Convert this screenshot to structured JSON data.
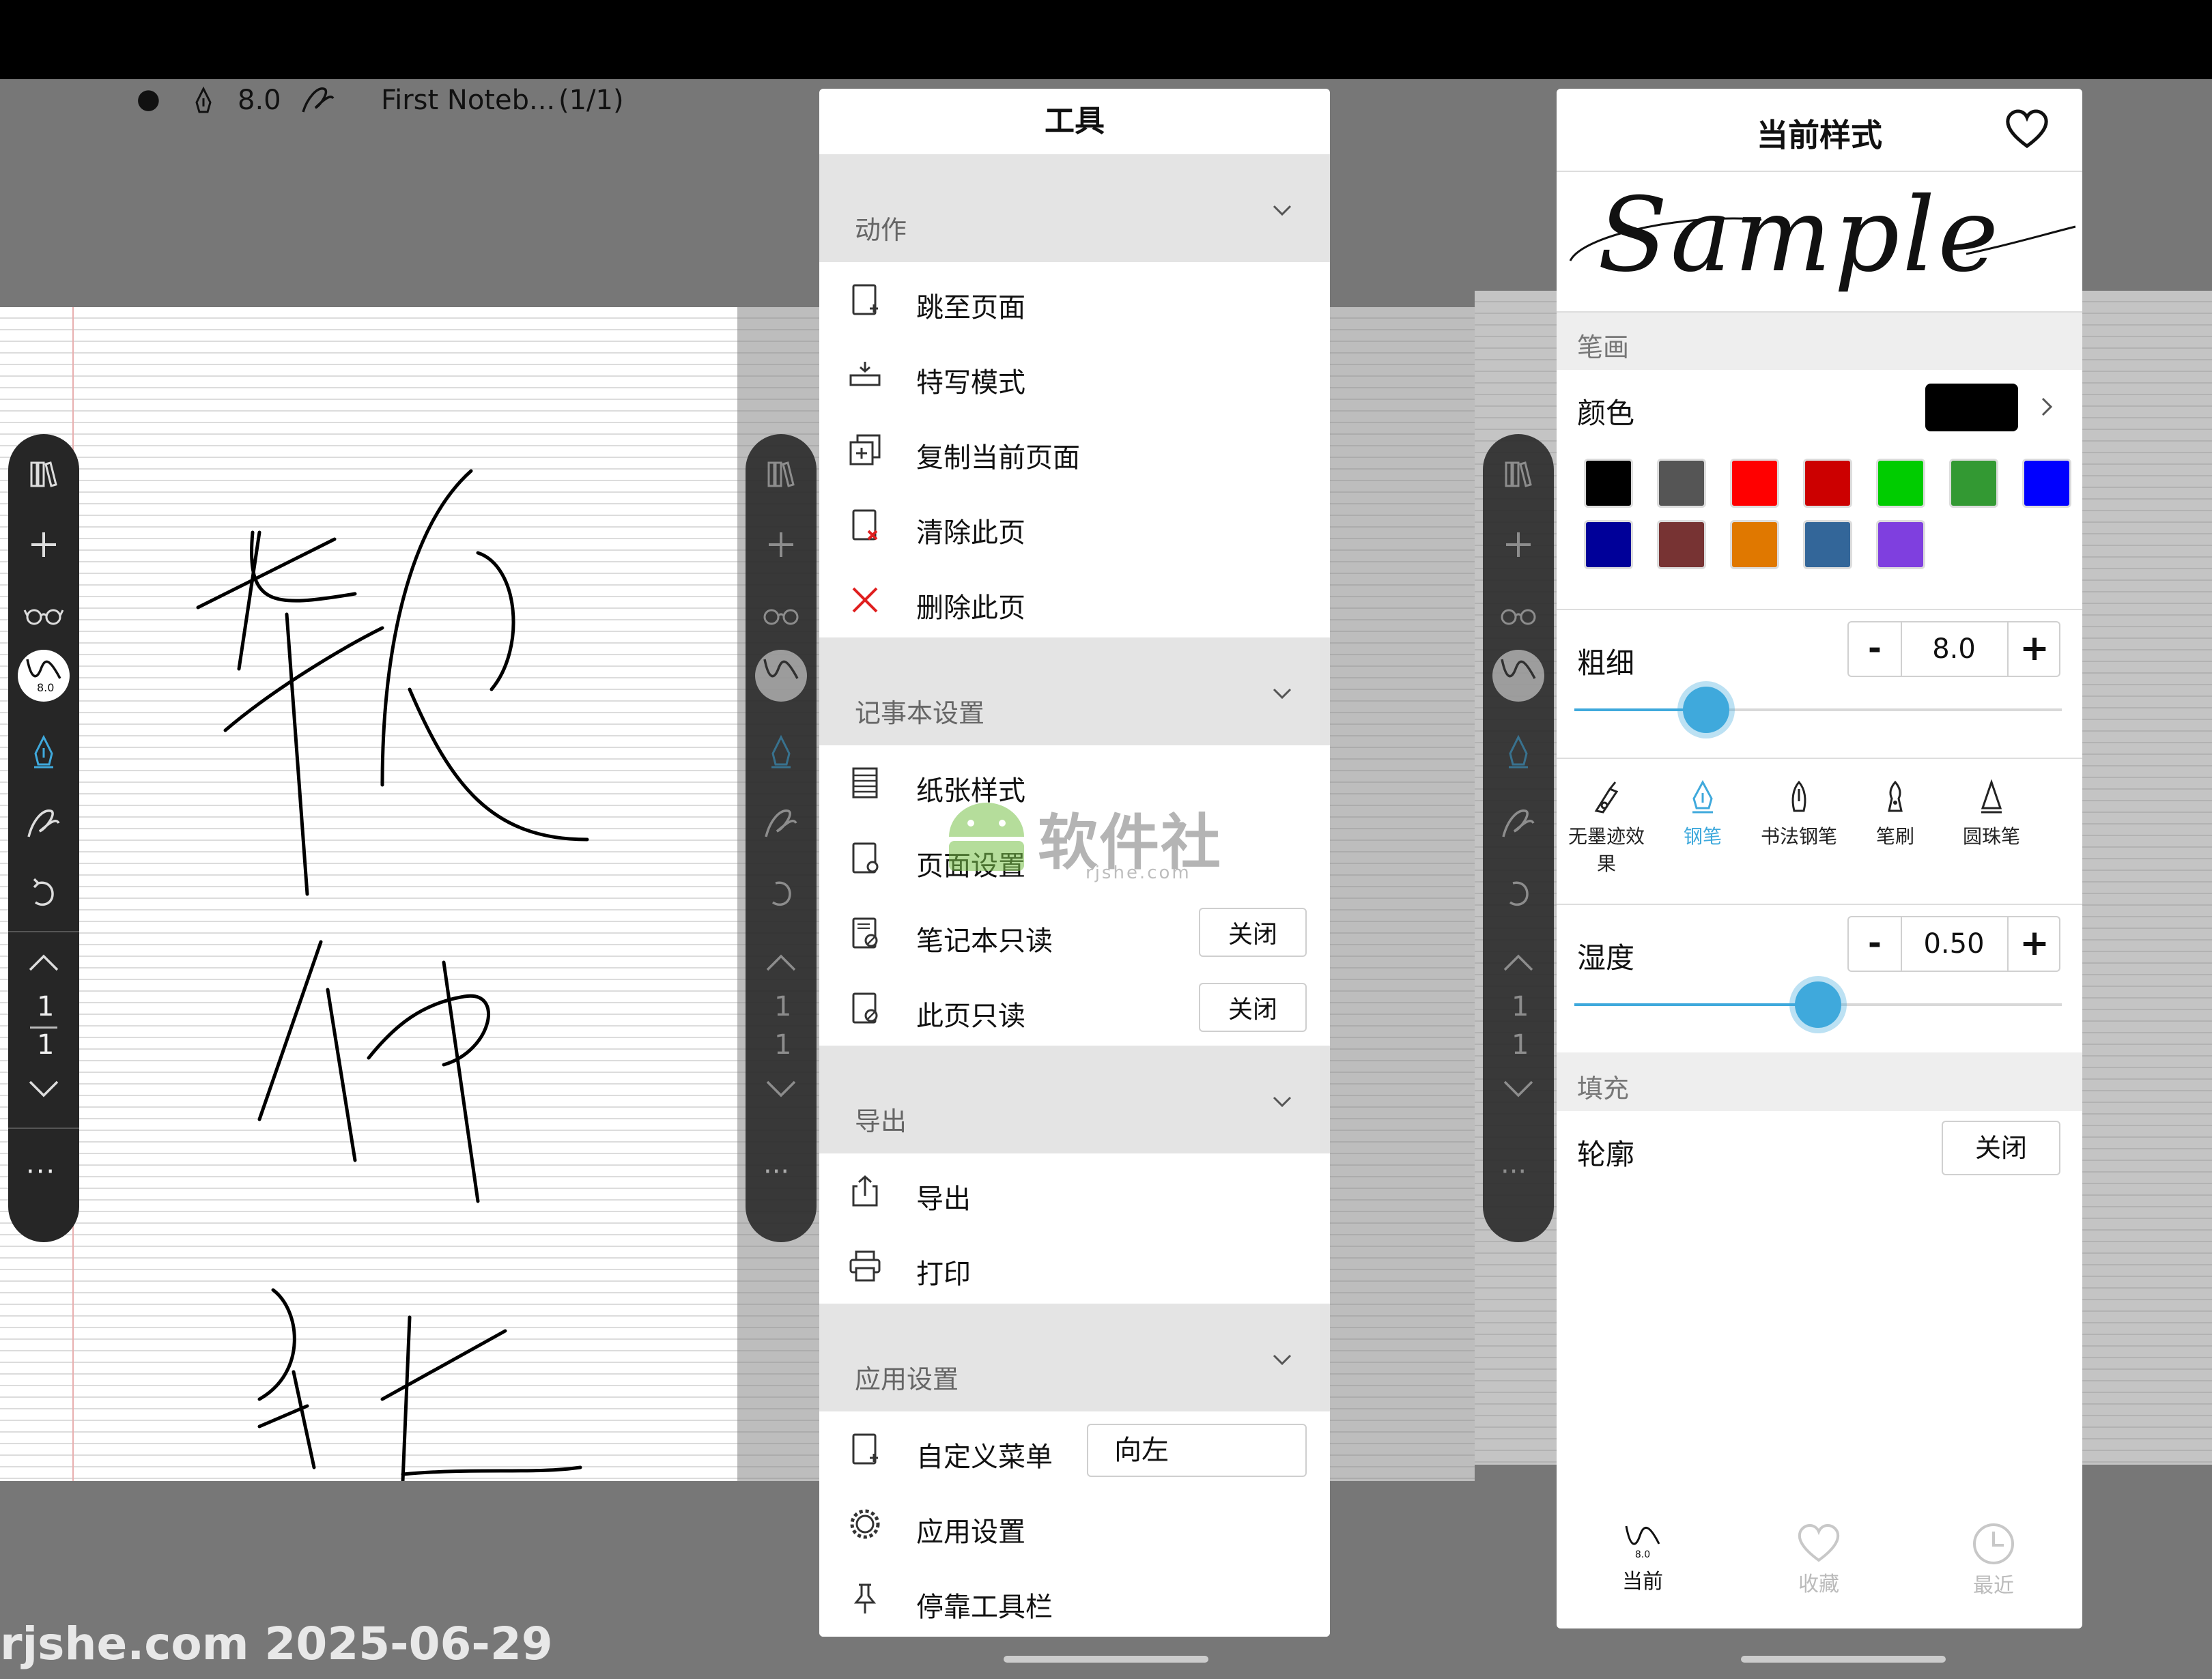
{
  "status_bar": {
    "dot": "●",
    "pen_size": "8.0",
    "notebook": "First Noteb...",
    "page_count": "(1/1)"
  },
  "toolbar": {
    "brush_size": "8.0",
    "page_current": "1",
    "page_total": "1",
    "more": "···"
  },
  "tools_menu": {
    "title": "工具",
    "sections": [
      {
        "title": "动作",
        "items": [
          "跳至页面",
          "特写模式",
          "复制当前页面",
          "清除此页",
          "删除此页"
        ]
      },
      {
        "title": "记事本设置",
        "items": [
          "纸张样式",
          "页面设置",
          "笔记本只读",
          "此页只读"
        ]
      },
      {
        "title": "导出",
        "items": [
          "导出",
          "打印"
        ]
      },
      {
        "title": "应用设置",
        "items": [
          "自定义菜单",
          "应用设置",
          "停靠工具栏"
        ]
      }
    ],
    "notebook_readonly_value": "关闭",
    "page_readonly_value": "关闭",
    "custom_menu_value": "向左"
  },
  "watermark": {
    "brand": "软件社",
    "domain": "rjshe.com"
  },
  "style_panel": {
    "title": "当前样式",
    "sample_text": "Sample",
    "stroke_section": "笔画",
    "color_label": "颜色",
    "current_color": "#000000",
    "palette": [
      "#000000",
      "#555555",
      "#ff0000",
      "#cc0000",
      "#00cc00",
      "#339933",
      "#0000ff",
      "#000099",
      "#773333",
      "#e07800",
      "#336699",
      "#7f3fdf"
    ],
    "thickness_label": "粗细",
    "thickness_value": "8.0",
    "thickness_fraction": 0.27,
    "minus": "-",
    "plus": "+",
    "pen_types": [
      {
        "label": "无墨迹效果",
        "icon": "nib-plain-icon",
        "active": false
      },
      {
        "label": "钢笔",
        "icon": "fountain-pen-icon",
        "active": true
      },
      {
        "label": "书法钢笔",
        "icon": "calligraphy-pen-icon",
        "active": false
      },
      {
        "label": "笔刷",
        "icon": "brush-icon",
        "active": false
      },
      {
        "label": "圆珠笔",
        "icon": "ballpoint-icon",
        "active": false
      }
    ],
    "humidity_label": "湿度",
    "humidity_value": "0.50",
    "humidity_fraction": 0.5,
    "fill_section": "填充",
    "outline_label": "轮廓",
    "outline_value": "关闭",
    "tabs": [
      {
        "label": "当前",
        "active": true,
        "badge": "8.0"
      },
      {
        "label": "收藏",
        "active": false
      },
      {
        "label": "最近",
        "active": false
      }
    ],
    "accent_color": "#3fa9dc"
  },
  "footer_watermark": "rjshe.com 2025-06-29"
}
